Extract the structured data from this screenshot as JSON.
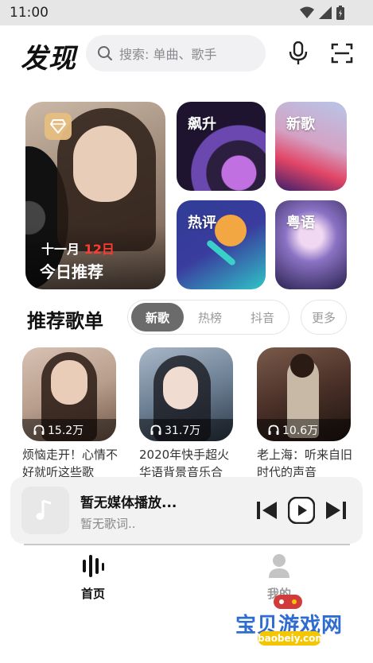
{
  "status_bar": {
    "time": "11:00"
  },
  "header": {
    "title": "发现",
    "search_placeholder": "搜索: 单曲、歌手"
  },
  "featured": {
    "month": "十一月",
    "day": "12日",
    "label": "今日推荐"
  },
  "tiles": [
    {
      "label": "飙升"
    },
    {
      "label": "新歌"
    },
    {
      "label": "热评"
    },
    {
      "label": "粤语"
    }
  ],
  "playlist_section": {
    "title": "推荐歌单",
    "tabs": [
      {
        "label": "新歌"
      },
      {
        "label": "热榜"
      },
      {
        "label": "抖音"
      }
    ],
    "more_label": "更多"
  },
  "playlists": [
    {
      "count": "15.2万",
      "title": "烦恼走开！心情不好就听这些歌"
    },
    {
      "count": "31.7万",
      "title": "2020年快手超火华语背景音乐合"
    },
    {
      "count": "10.6万",
      "title": "老上海：听来自旧时代的声音"
    }
  ],
  "player": {
    "title": "暂无媒体播放...",
    "subtitle": "暂无歌词.."
  },
  "bottom_nav": [
    {
      "label": "首页"
    },
    {
      "label": "我的"
    }
  ],
  "watermark": {
    "text": "宝贝游戏网",
    "url": "baobeiy.com"
  },
  "colors": {
    "accent_red": "#ff3b30",
    "active_pill": "#6b6b6b",
    "watermark_blue": "#2e6cd0",
    "watermark_yellow": "#f5c500"
  }
}
